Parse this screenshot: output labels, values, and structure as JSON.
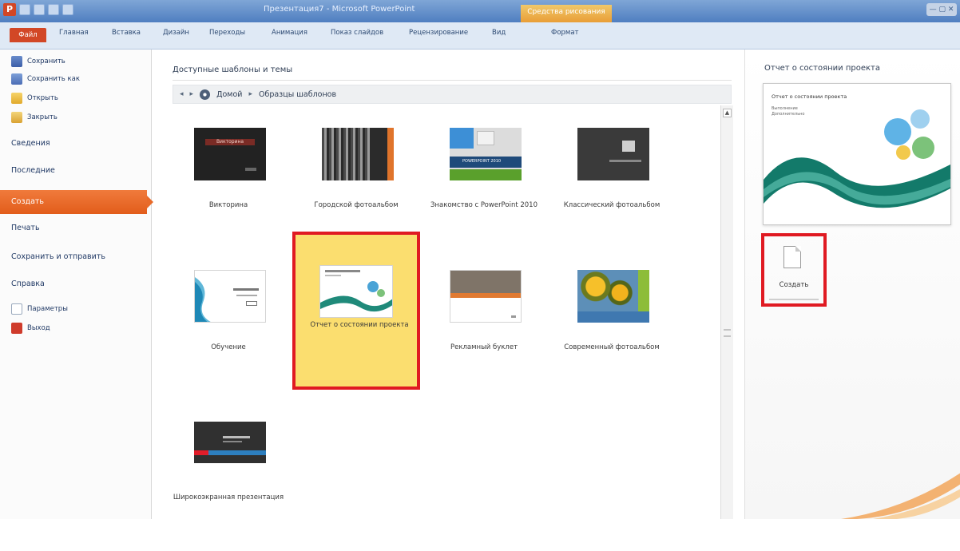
{
  "window": {
    "title": "Презентация7 - Microsoft PowerPoint",
    "context_tab_group": "Средства рисования",
    "controls": "— ▢ ✕"
  },
  "ribbon": {
    "file_tab": "Файл",
    "tabs": [
      "Главная",
      "Вставка",
      "Дизайн",
      "Переходы",
      "Анимация",
      "Показ слайдов",
      "Рецензирование",
      "Вид",
      "Формат"
    ]
  },
  "nav": {
    "save": "Сохранить",
    "save_as": "Сохранить как",
    "open": "Открыть",
    "close": "Закрыть",
    "info": "Сведения",
    "recent": "Последние",
    "new": "Создать",
    "print": "Печать",
    "save_send": "Сохранить и отправить",
    "help": "Справка",
    "options": "Параметры",
    "exit": "Выход"
  },
  "templates": {
    "section_title": "Доступные шаблоны и темы",
    "breadcrumb": {
      "home": "Домой",
      "current": "Образцы шаблонов"
    },
    "items": [
      {
        "label": "Викторина",
        "thumb_text": "Викторина"
      },
      {
        "label": "Городской фотоальбом",
        "thumb_text": ""
      },
      {
        "label": "Знакомство с PowerPoint 2010",
        "thumb_text": "POWERPOINT 2010"
      },
      {
        "label": "Классический фотоальбом",
        "thumb_text": ""
      },
      {
        "label": "Обучение",
        "thumb_text": ""
      },
      {
        "label": "Отчет о состоянии проекта",
        "thumb_text": ""
      },
      {
        "label": "Рекламный буклет",
        "thumb_text": ""
      },
      {
        "label": "Современный фотоальбом",
        "thumb_text": ""
      },
      {
        "label": "Широкоэкранная презентация",
        "thumb_text": ""
      }
    ],
    "selected_index": 5
  },
  "preview": {
    "title": "Отчет о состоянии проекта",
    "card_title": "Отчет о состоянии проекта",
    "card_subtitle_1": "Выполнение",
    "card_subtitle_2": "Дополнительно",
    "create_label": "Создать"
  },
  "colors": {
    "accent_orange": "#e86a29",
    "selection_red": "#e01a22",
    "selection_fill": "#fbde6f",
    "file_tab": "#d24726"
  }
}
